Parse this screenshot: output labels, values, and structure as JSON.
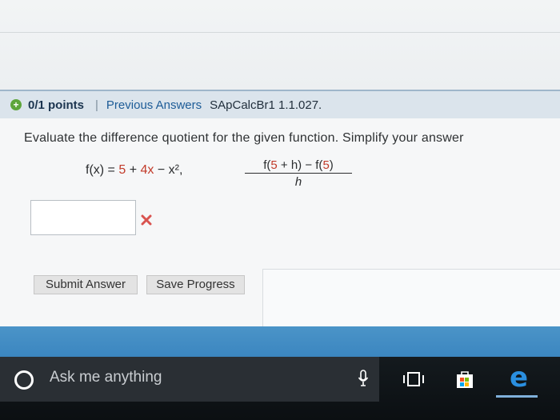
{
  "header": {
    "points": "0/1 points",
    "separator": "|",
    "previous_answers": "Previous Answers",
    "problem_code": "SApCalcBr1 1.1.027."
  },
  "question": {
    "text": "Evaluate the difference quotient for the given function. Simplify your answer",
    "function_lhs": "f(x) = ",
    "function_term1": "5",
    "function_plus1": " + ",
    "function_term2": "4x",
    "function_rest": " − x²,",
    "numerator_prefix": "f(",
    "numerator_a": "5",
    "numerator_mid": " + h) − f(",
    "numerator_b": "5",
    "numerator_suffix": ")",
    "denominator": "h"
  },
  "answer": {
    "value": "",
    "status": "incorrect"
  },
  "buttons": {
    "submit": "Submit Answer",
    "save": "Save Progress"
  },
  "taskbar": {
    "search_placeholder": "Ask me anything",
    "icons": [
      "cortana-icon",
      "microphone-icon",
      "task-view-icon",
      "store-icon",
      "edge-icon"
    ]
  },
  "colors": {
    "accent_blue": "#3b86c0",
    "error_red": "#c23b2a",
    "points_bar": "#dbe4ec",
    "taskbar": "#0b0f12"
  }
}
